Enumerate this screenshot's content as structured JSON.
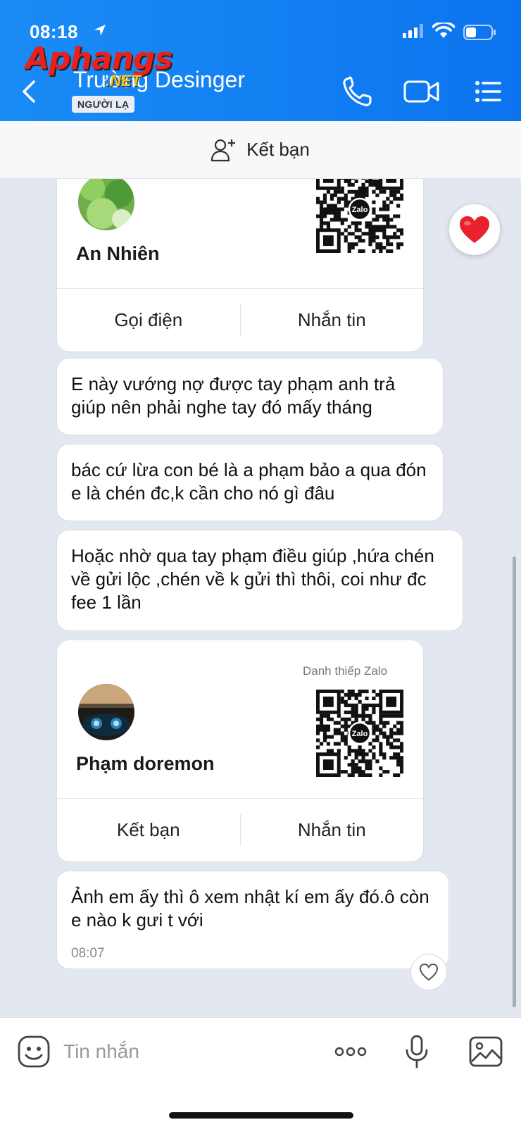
{
  "status_bar": {
    "time": "08:18"
  },
  "watermark": {
    "main": "Aphangs",
    "sub": ".NET"
  },
  "header": {
    "contact_name": "Trường Desinger",
    "badge": "NGƯỜI LẠ"
  },
  "add_friend_bar": {
    "label": "Kết bạn"
  },
  "messages": {
    "card1": {
      "name": "An Nhiên",
      "action_left": "Gọi điện",
      "action_right": "Nhắn tin"
    },
    "msg1": "E này vướng nợ được tay phạm anh trả giúp nên phải nghe tay đó mấy tháng",
    "msg2": "bác cứ lừa con bé là a phạm bảo a qua đón e là chén đc,k cần cho nó gì đâu",
    "msg3": "Hoặc nhờ qua tay phạm điều giúp ,hứa chén về gửi lộc ,chén về k gửi thì thôi, coi như đc fee 1 lần",
    "card2": {
      "tag": "Danh thiếp Zalo",
      "name": "Phạm doremon",
      "action_left": "Kết bạn",
      "action_right": "Nhắn tin"
    },
    "msg4": {
      "text": "Ảnh em ấy thì ô xem nhật kí em ấy đó.ô còn e nào k gưi t với",
      "time": "08:07"
    }
  },
  "qr_logo": "Zalo",
  "input": {
    "placeholder": "Tin nhắn"
  },
  "icons": {
    "back": "chevron-left-icon",
    "phone": "phone-icon",
    "video": "video-camera-icon",
    "menu": "list-menu-icon",
    "add_friend": "add-user-icon",
    "reaction": "heart-icon",
    "emoji": "emoji-icon",
    "more": "ellipsis-icon",
    "mic": "microphone-icon",
    "image": "image-icon"
  },
  "colors": {
    "header": "#1a8cf5",
    "chat_bg": "#e2e7f0",
    "heart": "#e8232d"
  }
}
